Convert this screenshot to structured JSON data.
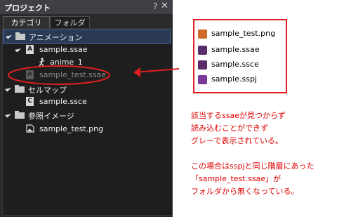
{
  "panel": {
    "title": "プロジェクト",
    "help_glyph": "?",
    "close_glyph": "✕",
    "tabs": [
      {
        "label": "カテゴリ",
        "active": true
      },
      {
        "label": "フォルダ",
        "active": false
      }
    ],
    "tree": [
      {
        "label": "アニメーション",
        "icon": "folder-icon",
        "expanded": true,
        "selected": true
      },
      {
        "label": "sample.ssae",
        "icon": "animation-file-icon",
        "icon_letter": "A",
        "expanded": true
      },
      {
        "label": "anime_1",
        "icon": "running-figure-icon"
      },
      {
        "label": "sample_test.ssae",
        "icon": "animation-file-icon",
        "icon_letter": "A",
        "missing": true
      },
      {
        "label": "セルマップ",
        "icon": "folder-icon",
        "expanded": true
      },
      {
        "label": "sample.ssce",
        "icon": "cellmap-file-icon",
        "icon_letter": "C"
      },
      {
        "label": "参照イメージ",
        "icon": "folder-icon",
        "expanded": true
      },
      {
        "label": "sample_test.png",
        "icon": "image-file-icon"
      }
    ]
  },
  "files": [
    {
      "label": "sample_test.png",
      "icon": "png-file-icon",
      "color": "#d06a2a"
    },
    {
      "label": "sample.ssae",
      "icon": "ssae-file-icon",
      "color": "#5a2a6a"
    },
    {
      "label": "sample.ssce",
      "icon": "ssce-file-icon",
      "color": "#5a2a6a"
    },
    {
      "label": "sample.sspj",
      "icon": "sspj-file-icon",
      "color": "#7a3a9a"
    }
  ],
  "note_lines": [
    "該当するssaeが見つからず",
    "読み込むことができず",
    "グレーで表示されている。",
    "",
    "この場合はsspjと同じ階層にあった",
    "「sample_test.ssae」が",
    "フォルダから無くなっている。"
  ],
  "colors": {
    "annotation_red": "#e02020",
    "missing_gray": "#8a8a8a",
    "selection_border": "#4d6fb0"
  }
}
